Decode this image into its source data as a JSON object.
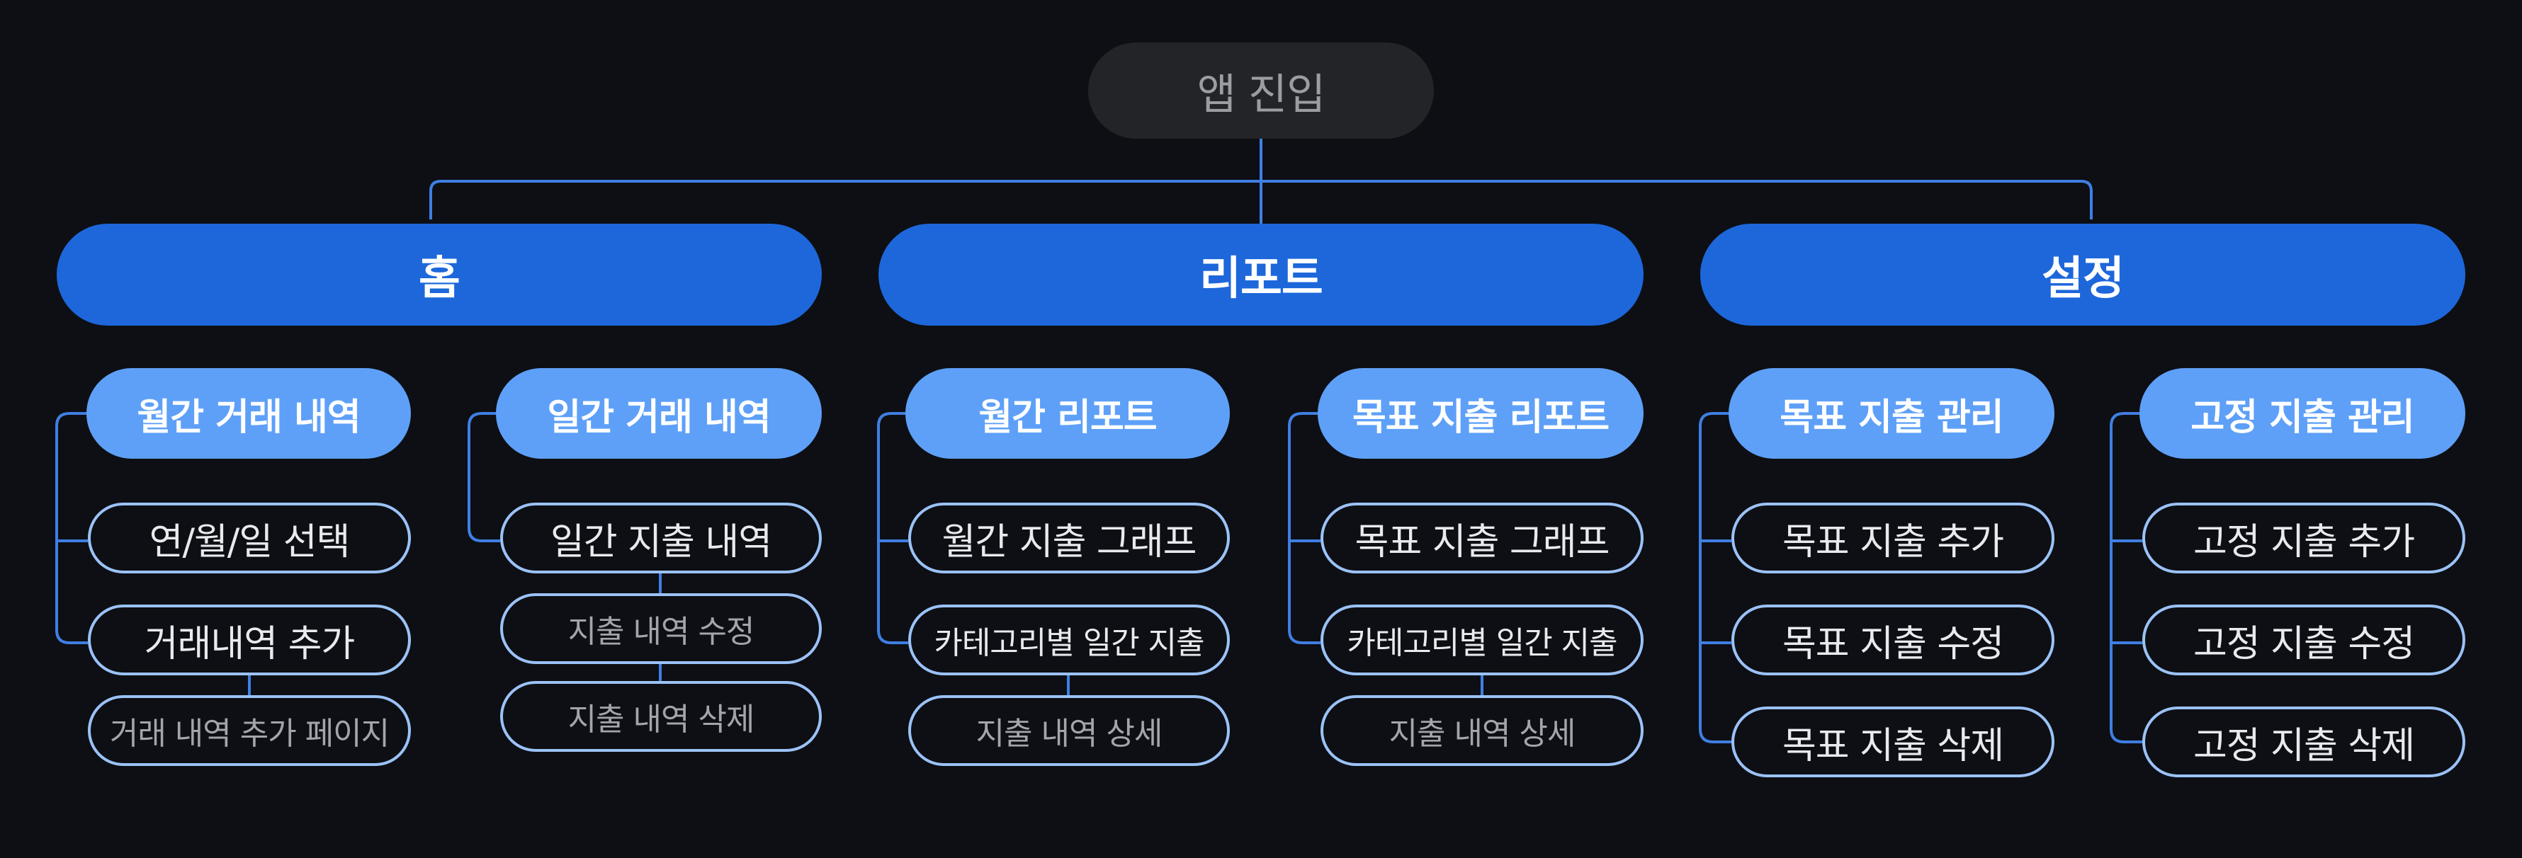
{
  "root": {
    "label": "앱 진입"
  },
  "sections": [
    {
      "label": "홈",
      "groups": [
        {
          "label": "월간 거래 내역",
          "items": [
            {
              "label": "연/월/일 선택"
            },
            {
              "label": "거래내역 추가"
            }
          ],
          "sub_items": [
            {
              "label": "거래 내역 추가 페이지"
            }
          ]
        },
        {
          "label": "일간 거래 내역",
          "items": [
            {
              "label": "일간 지출 내역"
            }
          ],
          "sub_items": [
            {
              "label": "지출 내역 수정"
            },
            {
              "label": "지출 내역 삭제"
            }
          ]
        }
      ]
    },
    {
      "label": "리포트",
      "groups": [
        {
          "label": "월간 리포트",
          "items": [
            {
              "label": "월간 지출 그래프"
            },
            {
              "label": "카테고리별 일간 지출"
            }
          ],
          "sub_items": [
            {
              "label": "지출 내역 상세"
            }
          ]
        },
        {
          "label": "목표 지출 리포트",
          "items": [
            {
              "label": "목표 지출 그래프"
            },
            {
              "label": "카테고리별 일간 지출"
            }
          ],
          "sub_items": [
            {
              "label": "지출 내역 상세"
            }
          ]
        }
      ]
    },
    {
      "label": "설정",
      "groups": [
        {
          "label": "목표 지출 관리",
          "items": [
            {
              "label": "목표 지출 추가"
            },
            {
              "label": "목표 지출 수정"
            },
            {
              "label": "목표 지출 삭제"
            }
          ],
          "sub_items": []
        },
        {
          "label": "고정 지출 관리",
          "items": [
            {
              "label": "고정 지출 추가"
            },
            {
              "label": "고정 지출 수정"
            },
            {
              "label": "고정 지출 삭제"
            }
          ],
          "sub_items": []
        }
      ]
    }
  ],
  "colors": {
    "background": "#0d0f14",
    "root_fill": "#232427",
    "section_fill": "#1d67db",
    "group_fill": "#5ea0f8",
    "item_border": "#9bc2f7",
    "connector": "#3f7fe3"
  }
}
